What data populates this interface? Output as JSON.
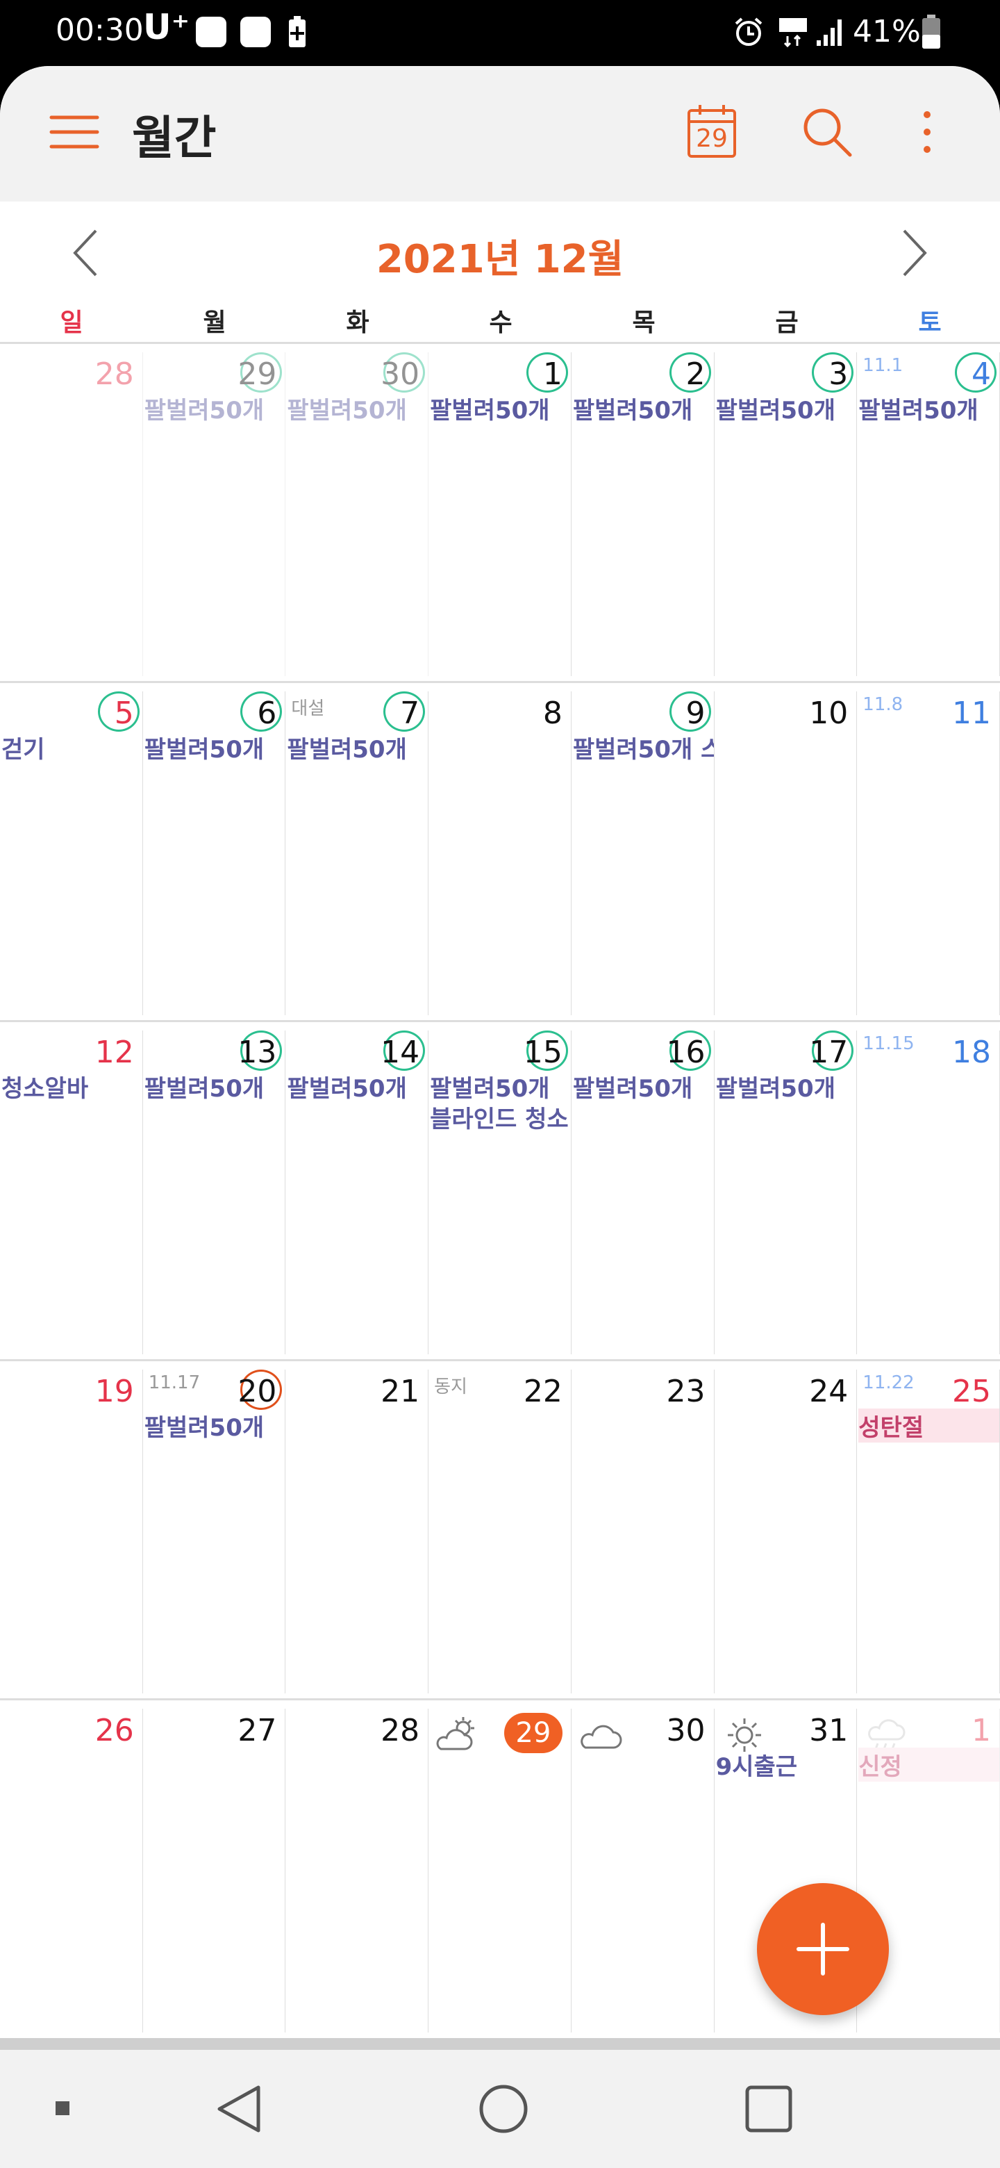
{
  "status_bar": {
    "time": "00:30",
    "carrier": "U⁺",
    "battery_percent": "41%"
  },
  "app_bar": {
    "menu_icon": "hamburger-menu-icon",
    "title": "월간",
    "today_button_day": "29",
    "search_icon": "search-icon",
    "more_icon": "more-vertical-icon"
  },
  "month_nav": {
    "title": "2021년 12월",
    "prev_icon": "chevron-left-icon",
    "next_icon": "chevron-right-icon"
  },
  "weekdays": [
    "일",
    "월",
    "화",
    "수",
    "목",
    "금",
    "토"
  ],
  "colors": {
    "accent": "#e8622a",
    "sunday": "#e5334a",
    "saturday": "#3f7fe0",
    "event_text": "#5a5aa0",
    "sticker_ring": "#2bbf8f",
    "holiday_bg": "#fce4ea"
  },
  "weeks": [
    [
      {
        "day": "28",
        "type": "sun",
        "muted": true
      },
      {
        "day": "29",
        "muted": true,
        "circle": true,
        "events": [
          "팔벌려50개"
        ]
      },
      {
        "day": "30",
        "muted": true,
        "circle": true,
        "events": [
          "팔벌려50개"
        ]
      },
      {
        "day": "1",
        "circle": true,
        "events": [
          "팔벌려50개"
        ]
      },
      {
        "day": "2",
        "circle": true,
        "events": [
          "팔벌려50개"
        ]
      },
      {
        "day": "3",
        "circle": true,
        "events": [
          "팔벌려50개"
        ]
      },
      {
        "day": "4",
        "type": "sat",
        "circle": true,
        "lunar": "11.1",
        "events": [
          "팔벌려50개"
        ]
      }
    ],
    [
      {
        "day": "5",
        "type": "sun",
        "circle": true,
        "events": [
          "걷기"
        ]
      },
      {
        "day": "6",
        "circle": true,
        "events": [
          "팔벌려50개"
        ]
      },
      {
        "day": "7",
        "circle": true,
        "lunar": "대설",
        "events": [
          "팔벌려50개"
        ]
      },
      {
        "day": "8"
      },
      {
        "day": "9",
        "circle": true,
        "events": [
          "팔벌려50개 스"
        ]
      },
      {
        "day": "10"
      },
      {
        "day": "11",
        "type": "sat",
        "lunar": "11.8"
      }
    ],
    [
      {
        "day": "12",
        "type": "sun",
        "events": [
          "청소알바"
        ]
      },
      {
        "day": "13",
        "circle": true,
        "events": [
          "팔벌려50개"
        ]
      },
      {
        "day": "14",
        "circle": true,
        "events": [
          "팔벌려50개"
        ]
      },
      {
        "day": "15",
        "circle": true,
        "events": [
          "팔벌려50개",
          "블라인드 청소"
        ]
      },
      {
        "day": "16",
        "circle": true,
        "events": [
          "팔벌려50개"
        ]
      },
      {
        "day": "17",
        "circle": true,
        "events": [
          "팔벌려50개"
        ]
      },
      {
        "day": "18",
        "type": "sat",
        "lunar": "11.15"
      }
    ],
    [
      {
        "day": "19",
        "type": "sun"
      },
      {
        "day": "20",
        "circle": true,
        "today_ring": true,
        "lunar": "11.17",
        "events": [
          "팔벌려50개"
        ]
      },
      {
        "day": "21"
      },
      {
        "day": "22",
        "lunar": "동지"
      },
      {
        "day": "23"
      },
      {
        "day": "24"
      },
      {
        "day": "25",
        "type": "holiday",
        "lunar": "11.22",
        "holiday": "성탄절"
      }
    ],
    [
      {
        "day": "26",
        "type": "sun"
      },
      {
        "day": "27"
      },
      {
        "day": "28"
      },
      {
        "day": "29",
        "today": true,
        "weather": "partly-sunny-icon"
      },
      {
        "day": "30",
        "weather": "cloud-icon"
      },
      {
        "day": "31",
        "weather": "sun-icon",
        "events": [
          "9시출근"
        ]
      },
      {
        "day": "1",
        "type": "holiday",
        "muted": true,
        "weather": "rain-cloud-icon",
        "holiday": "신정"
      }
    ]
  ],
  "fab_icon": "plus-icon",
  "nav_bar": {
    "icons": [
      "square-small-icon",
      "back-icon",
      "home-icon",
      "recents-icon"
    ]
  }
}
